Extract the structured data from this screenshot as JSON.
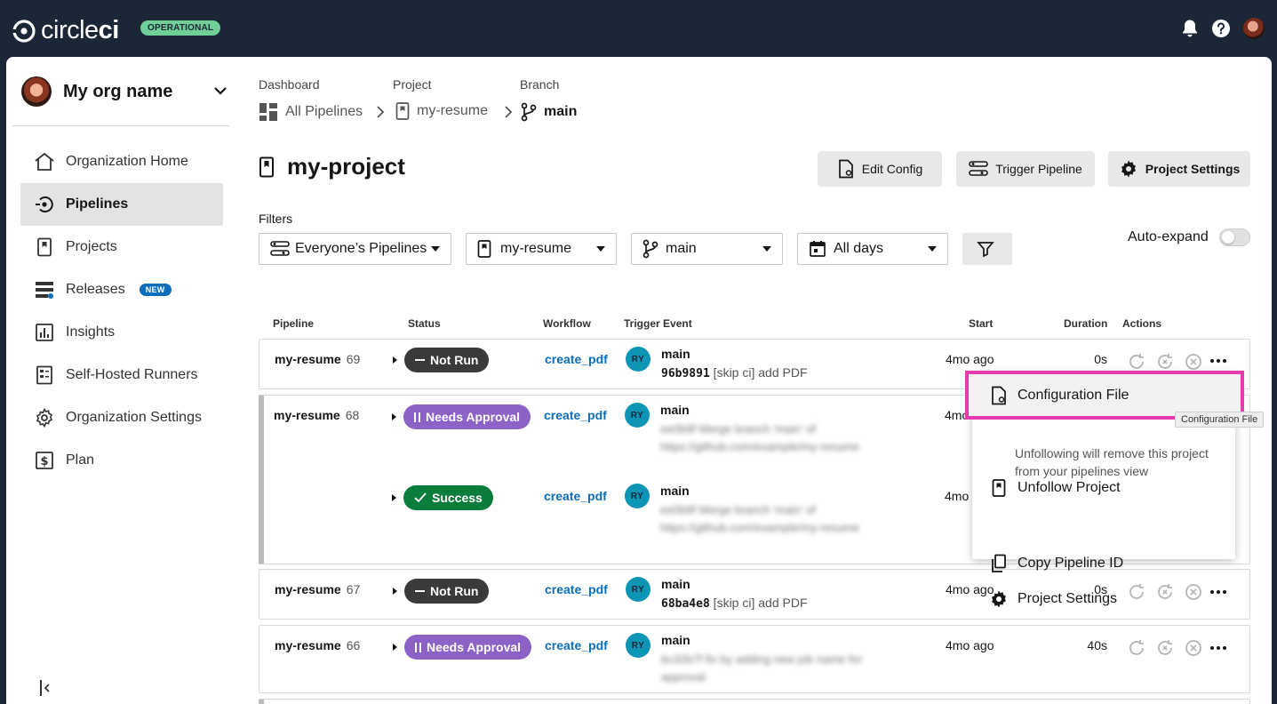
{
  "topbar": {
    "brand_light": "circle",
    "brand_bold": "ci",
    "status_label": "OPERATIONAL"
  },
  "sidebar": {
    "org_name": "My org name",
    "items": [
      {
        "label": "Organization Home",
        "icon": "home-icon"
      },
      {
        "label": "Pipelines",
        "icon": "pipelines-icon",
        "active": true
      },
      {
        "label": "Projects",
        "icon": "project-icon"
      },
      {
        "label": "Releases",
        "icon": "releases-icon",
        "badge": "NEW"
      },
      {
        "label": "Insights",
        "icon": "insights-icon"
      },
      {
        "label": "Self-Hosted Runners",
        "icon": "runners-icon"
      },
      {
        "label": "Organization Settings",
        "icon": "gear-icon"
      },
      {
        "label": "Plan",
        "icon": "dollar-icon"
      }
    ]
  },
  "breadcrumb": {
    "dashboard_label": "Dashboard",
    "dashboard_value": "All Pipelines",
    "project_label": "Project",
    "project_value": "my-resume",
    "branch_label": "Branch",
    "branch_value": "main"
  },
  "header": {
    "title": "my-project",
    "edit_config": "Edit Config",
    "trigger_pipeline": "Trigger Pipeline",
    "project_settings": "Project Settings"
  },
  "filters": {
    "label": "Filters",
    "pipelines": "Everyone’s Pipelines",
    "project": "my-resume",
    "branch": "main",
    "days": "All days",
    "auto_expand": "Auto-expand",
    "auto_expand_on": false
  },
  "table": {
    "headers": {
      "pipeline": "Pipeline",
      "status": "Status",
      "workflow": "Workflow",
      "trigger": "Trigger Event",
      "start": "Start",
      "duration": "Duration",
      "actions": "Actions"
    },
    "rows": [
      {
        "name": "my-resume",
        "num": "69",
        "status": "Not Run",
        "workflow": "create_pdf",
        "avatar": "RY",
        "branch": "main",
        "sha": "96b9891",
        "msg": " [skip ci] add PDF",
        "start": "4mo ago",
        "duration": "0s"
      },
      {
        "name": "my-resume",
        "num": "68",
        "status": "Needs Approval",
        "workflow": "create_pdf",
        "avatar": "RY",
        "branch": "main",
        "start": "4mo ago",
        "status2": "Success",
        "workflow2": "create_pdf",
        "avatar2": "RY",
        "branch2": "main",
        "start2": "4mo"
      },
      {
        "name": "my-resume",
        "num": "67",
        "status": "Not Run",
        "workflow": "create_pdf",
        "avatar": "RY",
        "branch": "main",
        "sha": "68ba4e8",
        "msg": " [skip ci] add PDF",
        "start": "4mo ago",
        "duration": "0s"
      },
      {
        "name": "my-resume",
        "num": "66",
        "status": "Needs Approval",
        "workflow": "create_pdf",
        "avatar": "RY",
        "branch": "main",
        "start": "4mo ago",
        "duration": "40s"
      }
    ]
  },
  "menu": {
    "config_file": "Configuration File",
    "unfollow": "Unfollow Project",
    "unfollow_desc": "Unfollowing will remove this project from your pipelines view",
    "copy_id": "Copy Pipeline ID",
    "project_settings": "Project Settings",
    "tooltip": "Configuration File"
  },
  "colors": {
    "topbar": "#1b2637",
    "operational": "#6fcf97",
    "link": "#0a6ebd",
    "not_run": "#3a3a3a",
    "needs_approval": "#8d62c7",
    "success": "#0a7d3c",
    "highlight": "#e63bb0"
  }
}
